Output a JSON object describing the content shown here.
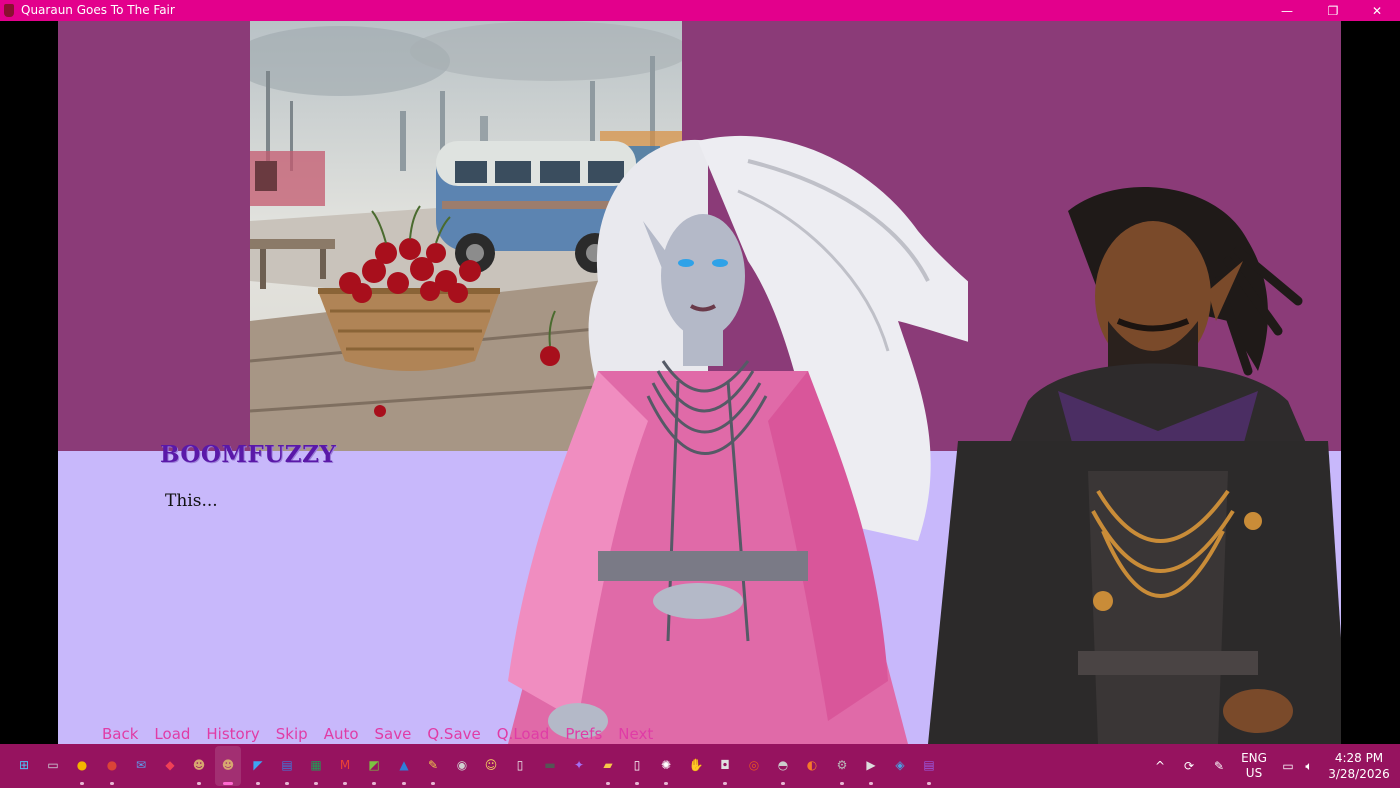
{
  "window": {
    "title": "Quaraun Goes To The Fair",
    "minimize_glyph": "—",
    "maximize_glyph": "❐",
    "close_glyph": "✕"
  },
  "game": {
    "speaker": "BOOMFUZZY",
    "dialogue": "This...",
    "colors": {
      "upper_bg": "#8b3b78",
      "lower_bg": "#c8b8fb",
      "menu_text": "#e03ca6",
      "speaker_text": "#5a18a8"
    },
    "quick_menu": [
      "Back",
      "Load",
      "History",
      "Skip",
      "Auto",
      "Save",
      "Q.Save",
      "Q.Load",
      "Prefs",
      "Next"
    ]
  },
  "taskbar": {
    "apps": [
      {
        "name": "start-icon",
        "glyph": "⊞",
        "color": "#4fc3f7"
      },
      {
        "name": "task-view-icon",
        "glyph": "▭",
        "color": "#cfd8dc"
      },
      {
        "name": "chrome-icon",
        "glyph": "●",
        "color": "#f4b400"
      },
      {
        "name": "chrome-alt-icon",
        "glyph": "●",
        "color": "#db4437"
      },
      {
        "name": "mail-icon",
        "glyph": "✉",
        "color": "#5c9ded"
      },
      {
        "name": "pocket-icon",
        "glyph": "◆",
        "color": "#ef4056"
      },
      {
        "name": "game-icon-1",
        "glyph": "☻",
        "color": "#d7a76f"
      },
      {
        "name": "game-icon-2",
        "glyph": "☻",
        "color": "#d7a76f"
      },
      {
        "name": "vscode-icon",
        "glyph": "◤",
        "color": "#3da5f4"
      },
      {
        "name": "document-icon",
        "glyph": "▤",
        "color": "#3d7be0"
      },
      {
        "name": "terminal-green-icon",
        "glyph": "▦",
        "color": "#1f9d55"
      },
      {
        "name": "gmail-icon",
        "glyph": "M",
        "color": "#ea4335"
      },
      {
        "name": "notes-icon",
        "glyph": "◩",
        "color": "#7cc242"
      },
      {
        "name": "photos-icon",
        "glyph": "▲",
        "color": "#2f7ed8"
      },
      {
        "name": "pencil-icon",
        "glyph": "✎",
        "color": "#f2c94c"
      },
      {
        "name": "alien-icon",
        "glyph": "◉",
        "color": "#d0d0d0"
      },
      {
        "name": "smiley-icon",
        "glyph": "☺",
        "color": "#f4d35e"
      },
      {
        "name": "clipboard-icon",
        "glyph": "▯",
        "color": "#eeeeee"
      },
      {
        "name": "console-icon",
        "glyph": "▬",
        "color": "#555555"
      },
      {
        "name": "copilot-icon",
        "glyph": "✦",
        "color": "#a46ef2"
      },
      {
        "name": "folder-icon",
        "glyph": "▰",
        "color": "#f7c948"
      },
      {
        "name": "file-icon",
        "glyph": "▯",
        "color": "#ffffff"
      },
      {
        "name": "openai-icon",
        "glyph": "✺",
        "color": "#ffffff"
      },
      {
        "name": "hand-icon",
        "glyph": "✋",
        "color": "#f2c94c"
      },
      {
        "name": "camera-icon",
        "glyph": "◘",
        "color": "#e0e0e0"
      },
      {
        "name": "ubuntu-icon",
        "glyph": "◎",
        "color": "#e95420"
      },
      {
        "name": "cat-icon",
        "glyph": "◓",
        "color": "#cccccc"
      },
      {
        "name": "blender-icon",
        "glyph": "◐",
        "color": "#f5792a"
      },
      {
        "name": "settings-icon",
        "glyph": "⚙",
        "color": "#bbbbbb"
      },
      {
        "name": "media-player-icon",
        "glyph": "▶",
        "color": "#dddddd"
      },
      {
        "name": "paint-icon",
        "glyph": "◈",
        "color": "#49a0e3"
      },
      {
        "name": "film-icon",
        "glyph": "▤",
        "color": "#9b59e0"
      }
    ],
    "tray": {
      "chevron": "^",
      "lang_top": "ENG",
      "lang_bottom": "US",
      "time": "4:28 PM",
      "date": "3/28/2026"
    }
  }
}
